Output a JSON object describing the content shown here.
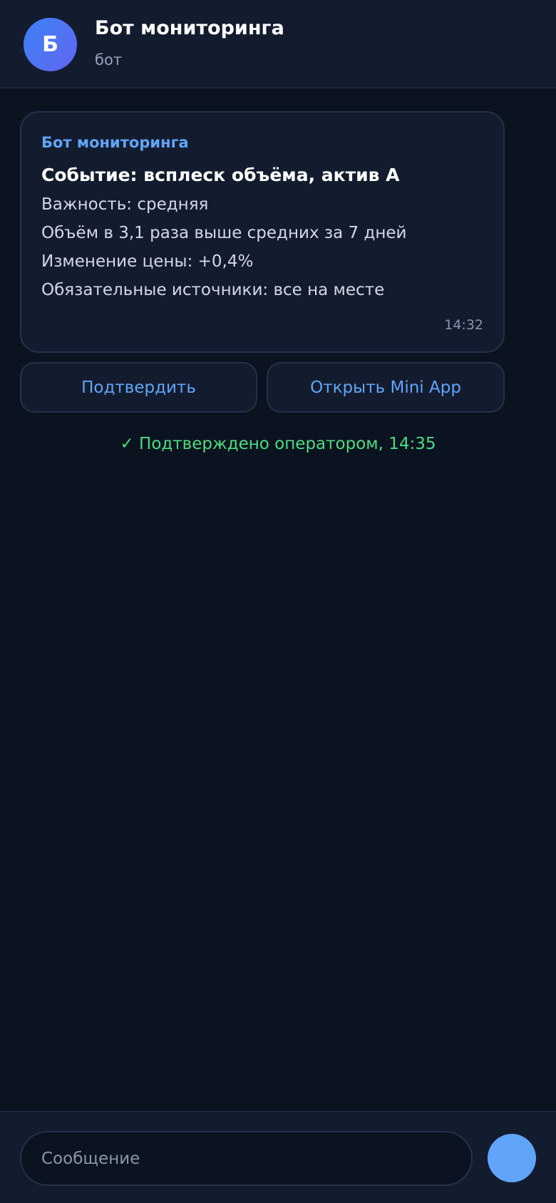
{
  "header": {
    "avatar_letter": "Б",
    "title": "Бот мониторинга",
    "subtitle": "бот"
  },
  "message": {
    "sender": "Бот мониторинга",
    "title": "Событие: всплеск объёма, актив A",
    "lines": [
      "Важность: средняя",
      "Объём в 3,1 раза выше средних за 7 дней",
      "Изменение цены: +0,4%",
      "Обязательные источники: все на месте"
    ],
    "time": "14:32"
  },
  "actions": {
    "confirm_label": "Подтвердить",
    "open_label": "Открыть Mini App"
  },
  "status": "✓ Подтверждено оператором, 14:35",
  "composer": {
    "placeholder": "Сообщение",
    "send_icon": "send-icon"
  },
  "colors": {
    "background": "#0b1220",
    "panel": "#131c2e",
    "accent": "#60a5fa",
    "success": "#4ade80"
  }
}
